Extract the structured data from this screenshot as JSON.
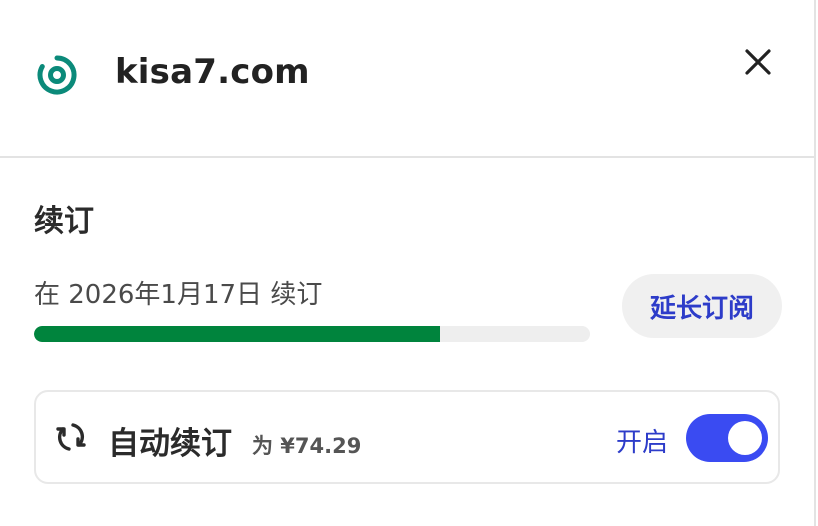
{
  "header": {
    "domain": "kisa7.com",
    "logo_icon": "target-ring-icon",
    "close_icon": "close-icon",
    "accent_color": "#0b8a7a"
  },
  "renewal": {
    "title": "续订",
    "renew_text": "在 2026年1月17日 续订",
    "progress_percent": 73,
    "progress_color": "#00843d",
    "extend_button": "延长订阅"
  },
  "auto_renew": {
    "icon": "refresh-icon",
    "label": "自动续订",
    "price_text": "为 ¥74.29",
    "status": "开启",
    "enabled": true,
    "toggle_color": "#3a4bf2"
  }
}
